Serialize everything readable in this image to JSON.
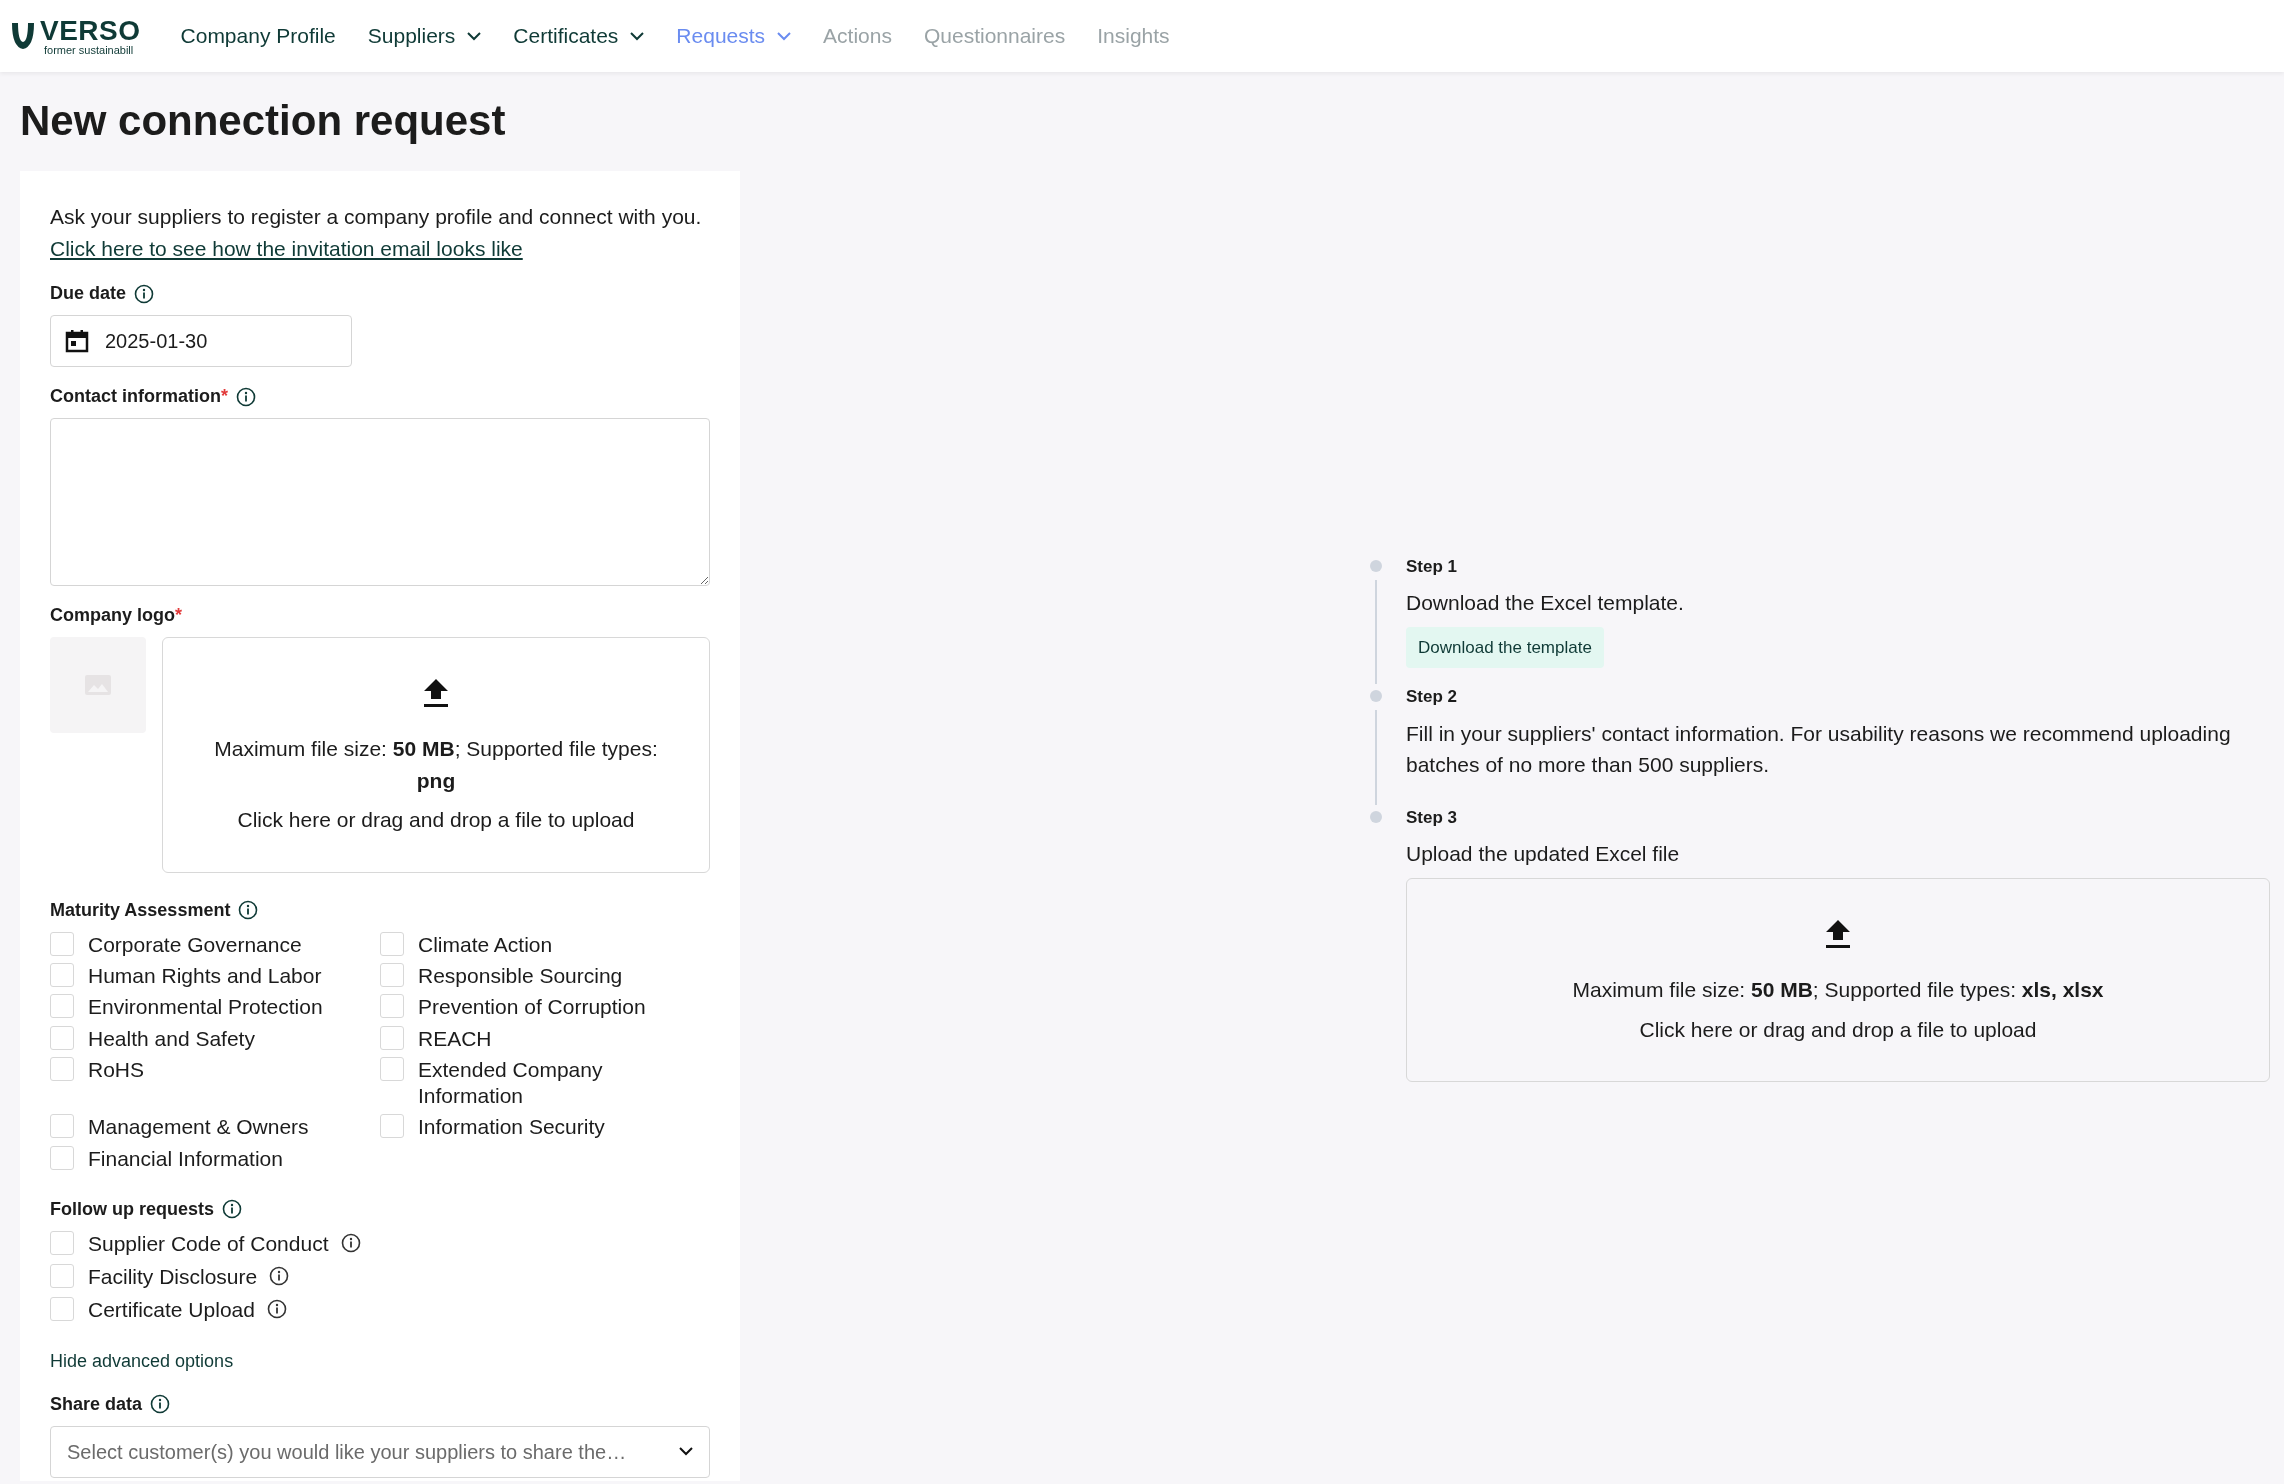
{
  "logo": {
    "name": "VERSO",
    "tagline": "former sustainabill"
  },
  "nav": [
    {
      "label": "Company Profile",
      "dropdown": false,
      "selected": false,
      "muted": false
    },
    {
      "label": "Suppliers",
      "dropdown": true,
      "selected": false,
      "muted": false
    },
    {
      "label": "Certificates",
      "dropdown": true,
      "selected": false,
      "muted": false
    },
    {
      "label": "Requests",
      "dropdown": true,
      "selected": true,
      "muted": false
    },
    {
      "label": "Actions",
      "dropdown": false,
      "selected": false,
      "muted": true
    },
    {
      "label": "Questionnaires",
      "dropdown": false,
      "selected": false,
      "muted": true
    },
    {
      "label": "Insights",
      "dropdown": false,
      "selected": false,
      "muted": true
    }
  ],
  "title": "New connection request",
  "form": {
    "intro": "Ask your suppliers to register a company profile and connect with you.",
    "intro_link": "Click here to see how the invitation email looks like",
    "due_date": {
      "label": "Due date",
      "value": "2025-01-30"
    },
    "contact": {
      "label": "Contact information",
      "required_mark": "*"
    },
    "logo_upload": {
      "label": "Company logo",
      "required_mark": "*",
      "info": "Maximum file size: **50 MB**; Supported file types: **png**",
      "action": "Click here or drag and drop a file to upload"
    },
    "maturity": {
      "label": "Maturity Assessment",
      "items": [
        {
          "label": "Corporate Governance",
          "checked": false
        },
        {
          "label": "Climate Action",
          "checked": false
        },
        {
          "label": "Human Rights and Labor",
          "checked": false
        },
        {
          "label": "Responsible Sourcing",
          "checked": false
        },
        {
          "label": "Environmental Protection",
          "checked": false
        },
        {
          "label": "Prevention of Corruption",
          "checked": false
        },
        {
          "label": "Health and Safety",
          "checked": false
        },
        {
          "label": "REACH",
          "checked": false
        },
        {
          "label": "RoHS",
          "checked": false
        },
        {
          "label": "Extended Company Information",
          "checked": false
        },
        {
          "label": "Management & Owners",
          "checked": false
        },
        {
          "label": "Information Security",
          "checked": false
        },
        {
          "label": "Financial Information",
          "checked": false
        }
      ]
    },
    "follow_up": {
      "label": "Follow up requests",
      "items": [
        {
          "label": "Supplier Code of Conduct",
          "checked": false
        },
        {
          "label": "Facility Disclosure",
          "checked": false
        },
        {
          "label": "Certificate Upload",
          "checked": false
        }
      ]
    },
    "advanced_toggle": "Hide advanced options",
    "share_data": {
      "label": "Share data",
      "placeholder": "Select customer(s) you would like your suppliers to share the…"
    }
  },
  "steps": [
    {
      "title": "Step 1",
      "text": "Download the Excel template.",
      "kind": "button",
      "button": "Download the template"
    },
    {
      "title": "Step 2",
      "text": "Fill in your suppliers' contact information. For usability reasons we recommend uploading batches of no more than 500 suppliers.",
      "kind": "text"
    },
    {
      "title": "Step 3",
      "text": "Upload the updated Excel file",
      "kind": "upload",
      "info": "Maximum file size: **50 MB**; Supported file types: **xls, xlsx**",
      "action": "Click here or drag and drop a file to upload"
    }
  ]
}
